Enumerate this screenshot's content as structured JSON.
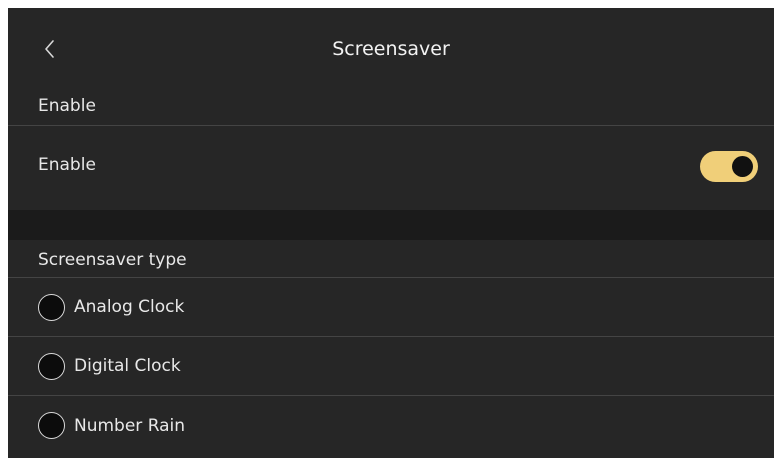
{
  "header": {
    "back_icon": "chevron-left-icon",
    "title": "Screensaver"
  },
  "enable_section": {
    "label": "Enable",
    "row_label": "Enable",
    "toggle_on": true,
    "toggle_color": "#f0cf79"
  },
  "type_section": {
    "label": "Screensaver type",
    "options": [
      {
        "label": "Analog Clock",
        "selected": false
      },
      {
        "label": "Digital Clock",
        "selected": false
      },
      {
        "label": "Number Rain",
        "selected": false
      }
    ]
  }
}
